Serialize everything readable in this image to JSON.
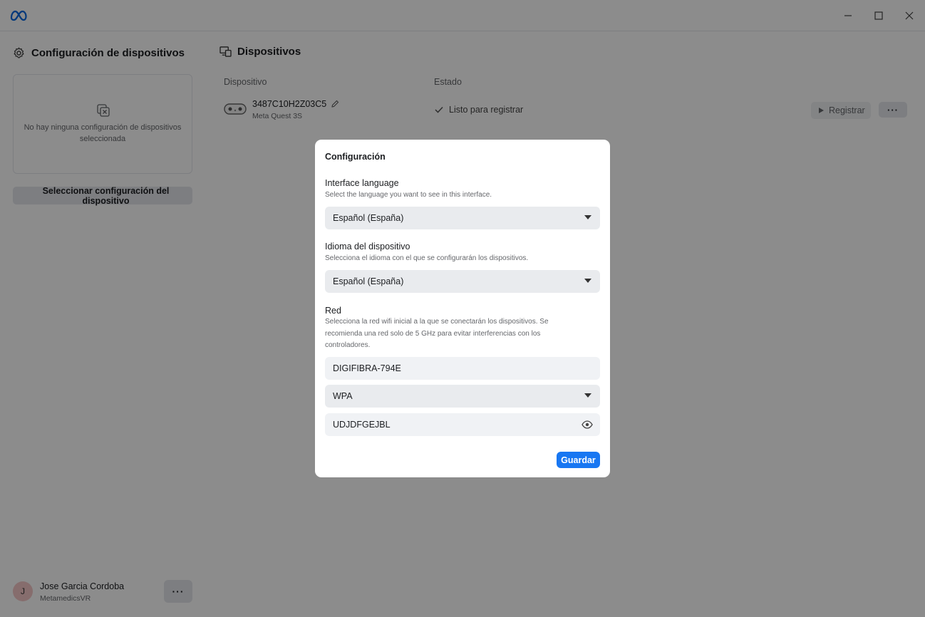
{
  "window": {
    "logo_icon": "meta-logo-icon",
    "controls": [
      "minimize-icon",
      "maximize-icon",
      "close-icon"
    ]
  },
  "sidebar": {
    "title": "Configuración de dispositivos",
    "title_icon": "gear-icon",
    "empty_message": "No hay ninguna configuración de dispositivos seleccionada",
    "select_button_label": "Seleccionar configuración del dispositivo",
    "user": {
      "initial": "J",
      "name": "Jose Garcia Cordoba",
      "organization": "MetamedicsVR",
      "more_label": "···"
    }
  },
  "main": {
    "title": "Dispositivos",
    "columns": {
      "device": "Dispositivo",
      "status": "Estado"
    },
    "devices": [
      {
        "id": "3487C10H2Z03C5",
        "model": "Meta Quest 3S",
        "status": "Listo para registrar",
        "register_label": "Registrar",
        "more_label": "···"
      }
    ]
  },
  "modal": {
    "title": "Configuración",
    "interface_language": {
      "label": "Interface language",
      "hint": "Select the language you want to see in this interface.",
      "value": "Español (España)"
    },
    "device_language": {
      "label": "Idioma del dispositivo",
      "hint": "Selecciona el idioma con el que se configurarán los dispositivos.",
      "value": "Español (España)"
    },
    "network": {
      "label": "Red",
      "hint": "Selecciona la red wifi inicial a la que se conectarán los dispositivos. Se recomienda una red solo de 5 GHz para evitar interferencias con los controladores.",
      "ssid": "DIGIFIBRA-794E",
      "security": "WPA",
      "password": "UDJDFGEJBL"
    },
    "save_label": "Guardar"
  },
  "colors": {
    "accent": "#1877f2",
    "overlay": "rgba(0,0,0,0.45)",
    "field_bg": "#e9ebee"
  }
}
